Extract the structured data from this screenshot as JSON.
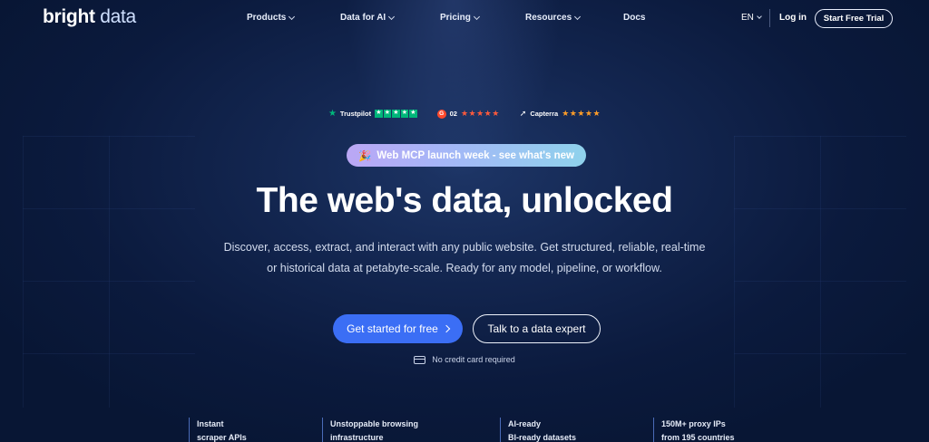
{
  "nav": {
    "logo_bold": "bright",
    "logo_light": "data",
    "items": [
      {
        "label": "Products",
        "dropdown": true
      },
      {
        "label": "Data for AI",
        "dropdown": true
      },
      {
        "label": "Pricing",
        "dropdown": true
      },
      {
        "label": "Resources",
        "dropdown": true
      },
      {
        "label": "Docs",
        "dropdown": false
      }
    ],
    "language": "EN",
    "login": "Log in",
    "cta": "Start Free Trial"
  },
  "ratings": {
    "trustpilot": "Trustpilot",
    "g2": "02",
    "g2_logo": "G",
    "capterra": "Capterra"
  },
  "banner": "Web MCP launch week - see what's new",
  "hero": {
    "title": "The web's data, unlocked",
    "subtitle_line1": "Discover, access, extract, and interact with any public website. Get structured, reliable, real-time",
    "subtitle_line2": "or historical data at petabyte-scale. Ready for any model, pipeline, or workflow.",
    "primary_cta": "Get started for free",
    "secondary_cta": "Talk to a data expert",
    "note": "No credit card required"
  },
  "features": [
    {
      "line1": "Instant",
      "line2": "scraper APIs"
    },
    {
      "line1": "Unstoppable browsing",
      "line2": "infrastructure"
    },
    {
      "line1": "AI-ready",
      "line2": "BI-ready datasets"
    },
    {
      "line1": "150M+ proxy IPs",
      "line2": "from 195 countries"
    }
  ],
  "colors": {
    "background": "#0b1a3d",
    "primary_button": "#3b6ef5",
    "trustpilot_green": "#00b67a",
    "g2_red": "#ff492c",
    "capterra_orange": "#ff9d28"
  }
}
